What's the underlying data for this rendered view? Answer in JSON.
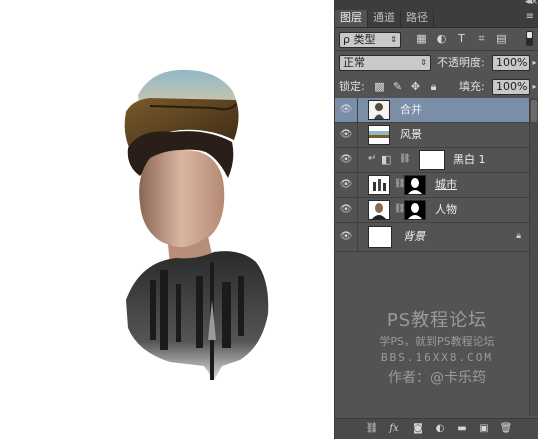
{
  "panel": {
    "tabs": [
      "图层",
      "通道",
      "路径"
    ],
    "active_tab": 0,
    "filter": {
      "kind_label": "ρ 类型"
    },
    "blend": {
      "mode": "正常",
      "opacity_label": "不透明度:",
      "opacity_value": "100%"
    },
    "lock_row": {
      "lock_label": "锁定:",
      "fill_label": "填充:",
      "fill_value": "100%"
    },
    "layers": [
      {
        "name": "合并",
        "selected": true
      },
      {
        "name": "风景",
        "selected": false
      },
      {
        "name": "黑白 1",
        "selected": false
      },
      {
        "name": "城市",
        "selected": false
      },
      {
        "name": "人物",
        "selected": false
      },
      {
        "name": "背景",
        "selected": false
      }
    ]
  },
  "watermark": {
    "title": "PS教程论坛",
    "subtitle": "学PS，就到PS教程论坛",
    "url": "BBS.16XX8.COM",
    "author": "作者：@卡乐筠"
  },
  "icons": {
    "eye": "eye-icon",
    "lock": "lock-icon",
    "chain": "link-icon",
    "menu": "panel-menu-icon"
  }
}
